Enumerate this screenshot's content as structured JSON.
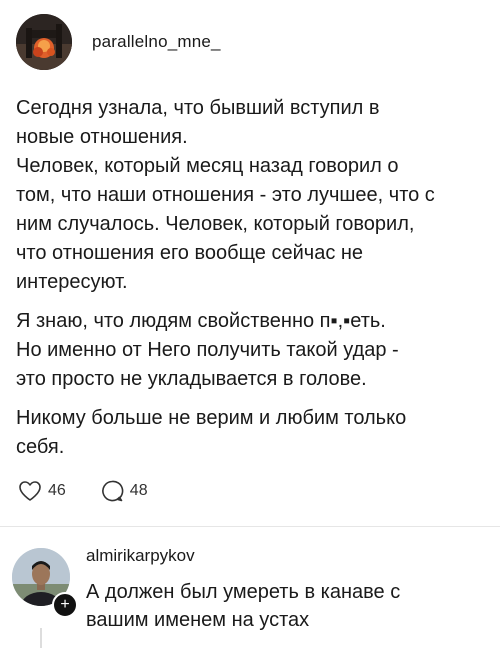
{
  "post": {
    "username": "parallelno_mne_",
    "paragraphs": [
      "Сегодня узнала, что бывший вступил в\nновые отношения.\nЧеловек, который месяц назад говорил о\nтом, что наши отношения - это лучшее, что с\nним случалось. Человек, который говорил,\nчто отношения его вообще сейчас не\nинтересуют.",
      "Я знаю, что людям свойственно п▪︎,▪︎еть.\nНо именно от Него получить такой удар -\nэто просто не укладывается в голове.",
      "Никому больше не верим и любим только\nсебя."
    ],
    "likes": "46",
    "comments": "48"
  },
  "reply": {
    "username": "almirikarpykov",
    "text": "А должен был умереть в канаве с\nвашим именем на устах",
    "follow_symbol": "+"
  },
  "icons": {
    "like": "heart-icon",
    "comment": "comment-bubble-icon"
  }
}
